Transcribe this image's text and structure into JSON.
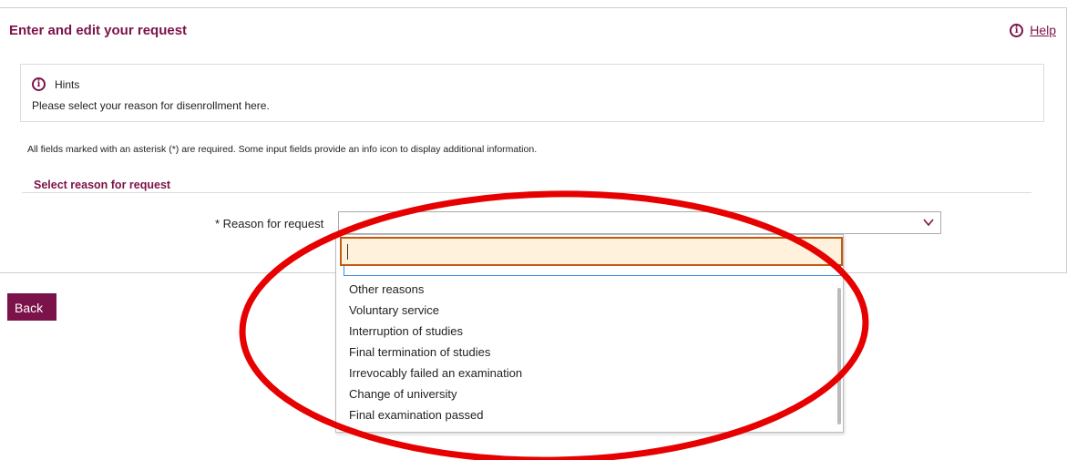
{
  "header": {
    "title": "Enter and edit your request",
    "help_label": "Help",
    "help_icon": "info-icon"
  },
  "hints": {
    "title": "Hints",
    "icon": "info-icon",
    "text": "Please select your reason for disenrollment here."
  },
  "form": {
    "required_note": "All fields marked with an asterisk (*) are required. Some input fields provide an info icon to display additional information.",
    "section_title": "Select reason for request",
    "reason_label": "* Reason for request",
    "reason_value": "",
    "search_value": ""
  },
  "dropdown": {
    "options": [
      "Other reasons",
      "Voluntary service",
      "Interruption of studies",
      "Final termination of studies",
      "Irrevocably failed an examination",
      "Change of university",
      "Final examination passed"
    ]
  },
  "actions": {
    "back_label": "Back"
  },
  "colors": {
    "accent": "#7b1249",
    "search_highlight_bg": "#fff1dc",
    "search_highlight_border": "#c25a11",
    "annotation_ellipse": "#e60000"
  }
}
